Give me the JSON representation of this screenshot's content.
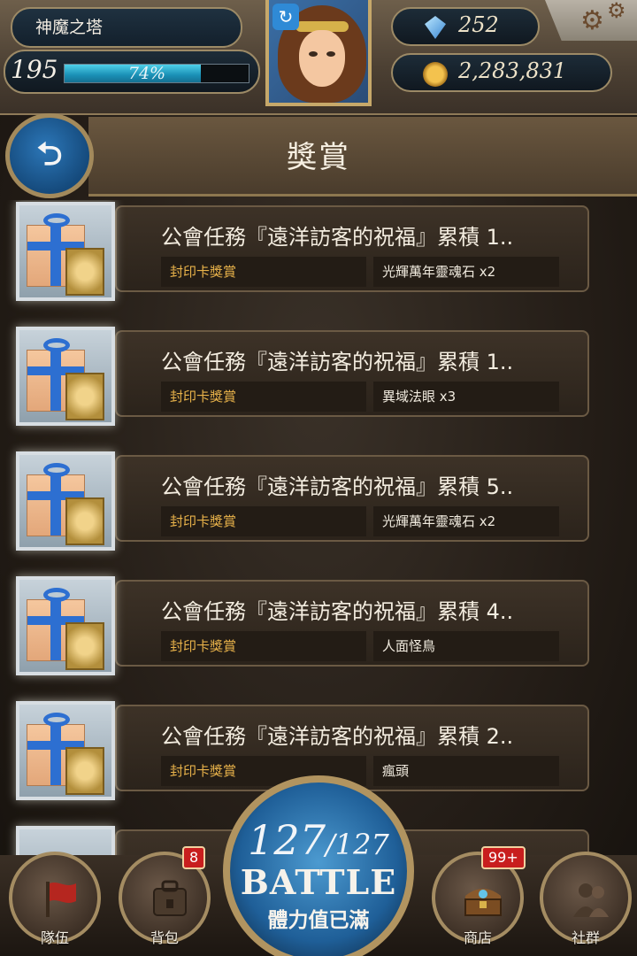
{
  "hud": {
    "game_title": "神魔之塔",
    "level": "195",
    "exp_percent_text": "74%",
    "exp_fraction": 0.74,
    "gems": "252",
    "coins": "2,283,831"
  },
  "header": {
    "title": "獎賞"
  },
  "rewards": [
    {
      "title": "公會任務『遠洋訪客的祝福』累積 1..",
      "tag": "封印卡獎賞",
      "item": "光輝萬年靈魂石 x2"
    },
    {
      "title": "公會任務『遠洋訪客的祝福』累積 1..",
      "tag": "封印卡獎賞",
      "item": "異域法眼 x3"
    },
    {
      "title": "公會任務『遠洋訪客的祝福』累積 5..",
      "tag": "封印卡獎賞",
      "item": "光輝萬年靈魂石 x2"
    },
    {
      "title": "公會任務『遠洋訪客的祝福』累積 4..",
      "tag": "封印卡獎賞",
      "item": "人面怪鳥"
    },
    {
      "title": "公會任務『遠洋訪客的祝福』累積 2..",
      "tag": "封印卡獎賞",
      "item": "瘋頭"
    }
  ],
  "nav": {
    "team": "隊伍",
    "backpack": "背包",
    "backpack_badge": "8",
    "shop": "商店",
    "shop_badge": "99+",
    "social": "社群"
  },
  "battle": {
    "stamina_current": "127",
    "stamina_max": "/127",
    "label": "BATTLE",
    "status": "體力值已滿"
  },
  "colors": {
    "accent_gold": "#e8b24a",
    "exp_cyan": "#4fd1ea",
    "badge_red": "#c81e1e"
  }
}
